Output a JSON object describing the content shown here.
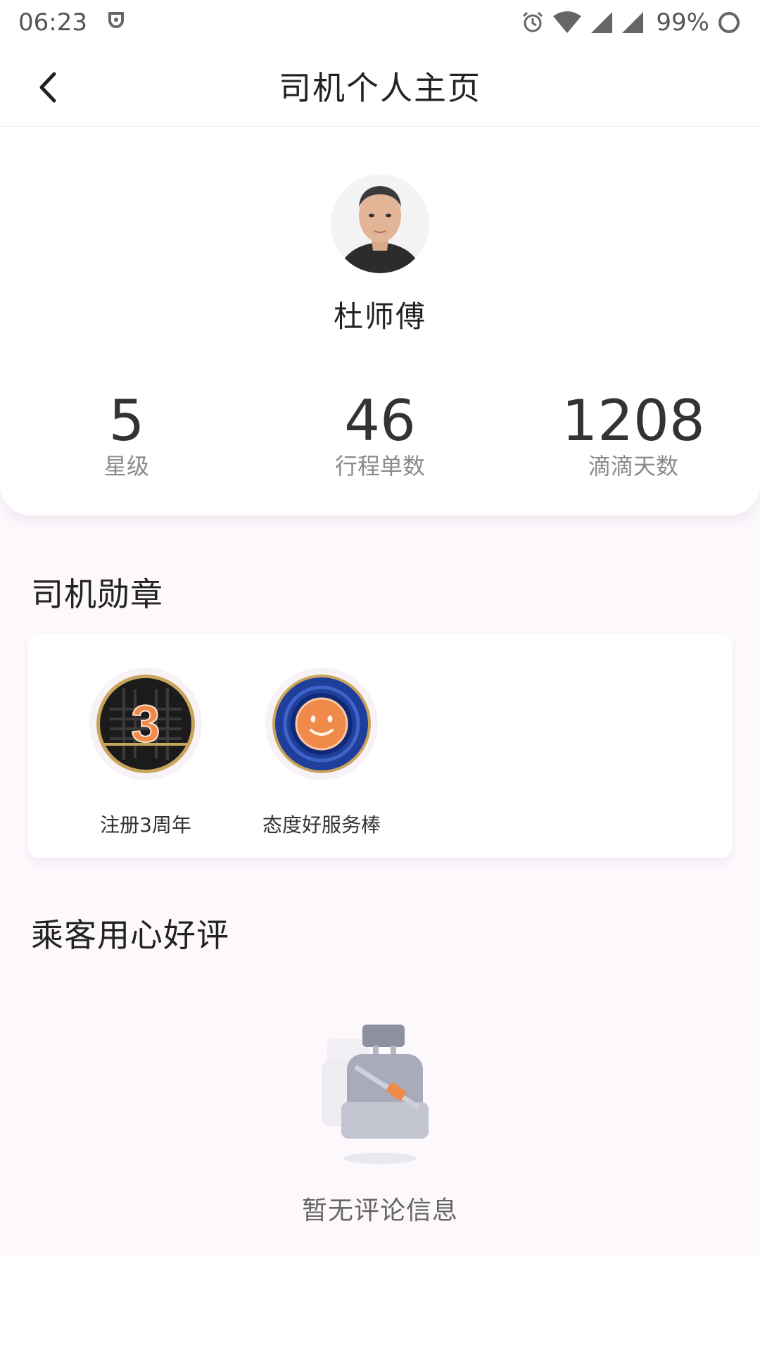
{
  "status_bar": {
    "time": "06:23",
    "battery": "99%",
    "icons": [
      "app-notification-icon",
      "alarm-icon",
      "wifi-icon",
      "signal-icon",
      "signal-icon",
      "battery-icon"
    ]
  },
  "header": {
    "title": "司机个人主页",
    "back_icon": "chevron-left-icon"
  },
  "profile": {
    "name": "杜师傅",
    "stats": [
      {
        "value": "5",
        "label": "星级"
      },
      {
        "value": "46",
        "label": "行程单数"
      },
      {
        "value": "1208",
        "label": "滴滴天数"
      }
    ]
  },
  "badges_section": {
    "title": "司机勋章",
    "badges": [
      {
        "label": "注册3周年",
        "icon": "anniversary-3-badge-icon"
      },
      {
        "label": "态度好服务棒",
        "icon": "smiley-service-badge-icon"
      }
    ]
  },
  "reviews_section": {
    "title": "乘客用心好评",
    "empty_text": "暂无评论信息",
    "empty_icon": "empty-seat-icon"
  },
  "colors": {
    "page_background": "#fcf8fc",
    "card": "#ffffff",
    "badge_orange": "#f08a4b",
    "badge_blue": "#1f3f9a",
    "badge_gold": "#c9a45c"
  }
}
